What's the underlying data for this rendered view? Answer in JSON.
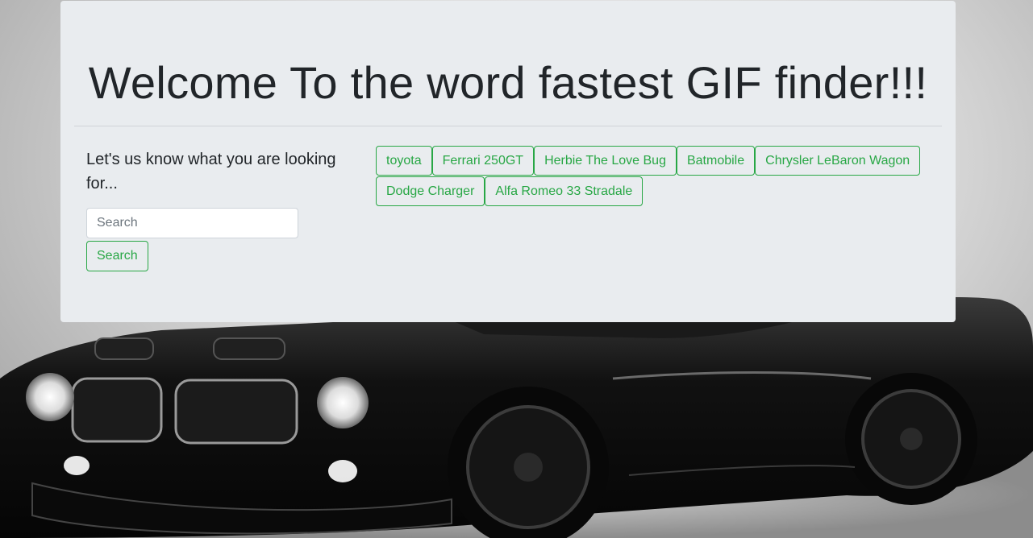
{
  "page": {
    "title": "Welcome To the word fastest GIF finder!!!"
  },
  "search": {
    "prompt": "Let's us know what you are looking for...",
    "placeholder": "Search",
    "button_label": "Search"
  },
  "tags": [
    "toyota",
    "Ferrari 250GT",
    "Herbie The Love Bug",
    "Batmobile",
    "Chrysler LeBaron Wagon",
    "Dodge Charger",
    "Alfa Romeo 33 Stradale"
  ],
  "colors": {
    "accent": "#28a745",
    "panel": "#e9ecef",
    "text": "#212529"
  },
  "background": {
    "subject": "black muscle car"
  }
}
